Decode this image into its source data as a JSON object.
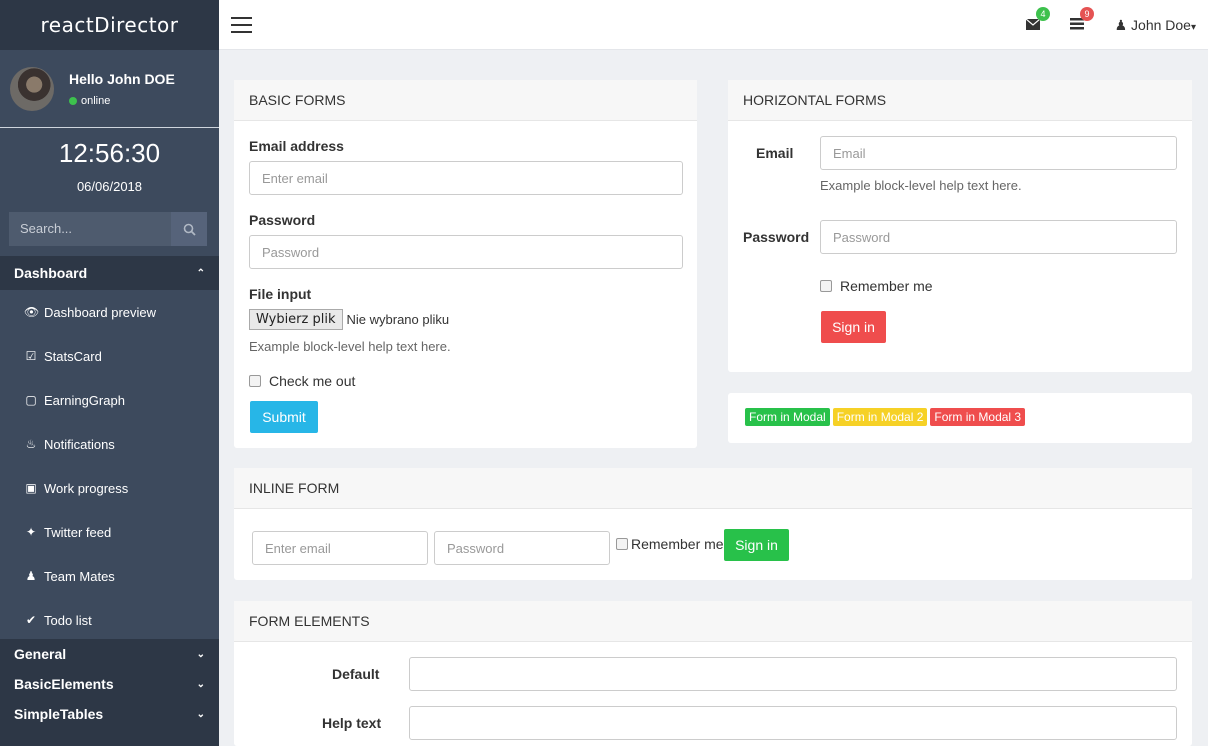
{
  "app": {
    "brand": "reactDirector"
  },
  "profile": {
    "greeting": "Hello John DOE",
    "status": "online"
  },
  "clock": {
    "time": "12:56:30",
    "date": "06/06/2018"
  },
  "search": {
    "placeholder": "Search..."
  },
  "sidebar": {
    "section": "Dashboard",
    "items": [
      {
        "label": "Dashboard preview",
        "icon": "eye-icon"
      },
      {
        "label": "StatsCard",
        "icon": "check-square-icon"
      },
      {
        "label": "EarningGraph",
        "icon": "area-chart-icon"
      },
      {
        "label": "Notifications",
        "icon": "bell-icon"
      },
      {
        "label": "Work progress",
        "icon": "briefcase-icon"
      },
      {
        "label": "Twitter feed",
        "icon": "twitter-icon"
      },
      {
        "label": "Team Mates",
        "icon": "user-icon"
      },
      {
        "label": "Todo list",
        "icon": "check-icon"
      }
    ],
    "groups": [
      "General",
      "BasicElements",
      "SimpleTables"
    ]
  },
  "topnav": {
    "mail_count": "4",
    "tasks_count": "9",
    "user": "John Doe"
  },
  "basic_forms": {
    "title": "BASIC FORMS",
    "email_label": "Email address",
    "email_placeholder": "Enter email",
    "password_label": "Password",
    "password_placeholder": "Password",
    "file_label": "File input",
    "file_button": "Wybierz plik",
    "file_status": "Nie wybrano pliku",
    "help": "Example block-level help text here.",
    "check_label": "Check me out",
    "submit": "Submit"
  },
  "horizontal_forms": {
    "title": "HORIZONTAL FORMS",
    "email_label": "Email",
    "email_placeholder": "Email",
    "help": "Example block-level help text here.",
    "password_label": "Password",
    "password_placeholder": "Password",
    "remember": "Remember me",
    "signin": "Sign in"
  },
  "modals": {
    "modal1": "Form in Modal",
    "modal2": "Form in Modal 2",
    "modal3": "Form in Modal 3"
  },
  "inline_form": {
    "title": "INLINE FORM",
    "email_placeholder": "Enter email",
    "password_placeholder": "Password",
    "remember": "Remember me",
    "signin": "Sign in"
  },
  "form_elements": {
    "title": "FORM ELEMENTS",
    "default_label": "Default",
    "help_label": "Help text"
  },
  "colors": {
    "sidebar": "#3d4a5d",
    "sidebar_dark": "#2d3746",
    "info": "#27b6e7",
    "danger": "#ef4d4d",
    "success": "#28c14a",
    "warning": "#f6d126"
  }
}
